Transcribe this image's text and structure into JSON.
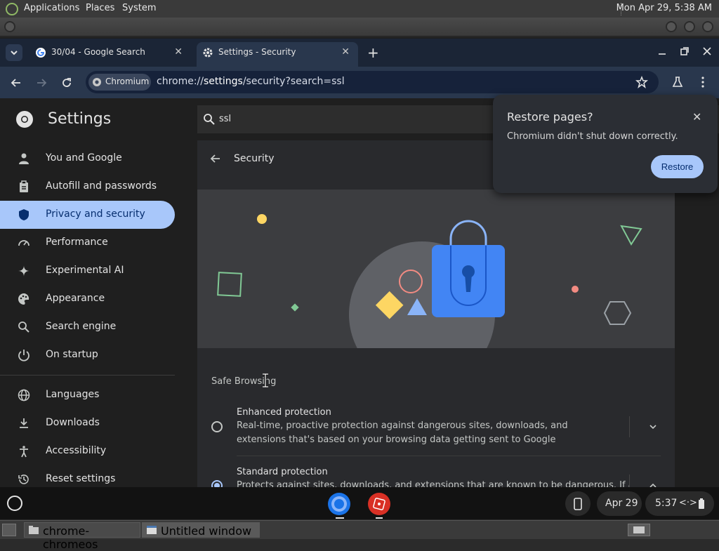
{
  "gnome_panel": {
    "menus": [
      "Applications",
      "Places",
      "System"
    ],
    "clock": "Mon Apr 29, 5:38 AM"
  },
  "tabs": [
    {
      "title": "30/04 - Google Search",
      "icon": "google-icon"
    },
    {
      "title": "Settings - Security",
      "icon": "gear-icon",
      "active": true
    }
  ],
  "toolbar": {
    "chip_label": "Chromium",
    "url_prefix": "chrome://",
    "url_host": "settings",
    "url_path": "/security?search=ssl"
  },
  "settings": {
    "title": "Settings",
    "search_value": "ssl",
    "nav": [
      {
        "label": "You and Google",
        "icon": "person-icon"
      },
      {
        "label": "Autofill and passwords",
        "icon": "clipboard-icon"
      },
      {
        "label": "Privacy and security",
        "icon": "shield-icon",
        "active": true
      },
      {
        "label": "Performance",
        "icon": "speedometer-icon"
      },
      {
        "label": "Experimental AI",
        "icon": "sparkle-icon"
      },
      {
        "label": "Appearance",
        "icon": "palette-icon"
      },
      {
        "label": "Search engine",
        "icon": "search-icon"
      },
      {
        "label": "On startup",
        "icon": "power-icon"
      },
      {
        "label": "Languages",
        "icon": "globe-icon"
      },
      {
        "label": "Downloads",
        "icon": "download-icon"
      },
      {
        "label": "Accessibility",
        "icon": "accessibility-icon"
      },
      {
        "label": "Reset settings",
        "icon": "history-icon"
      }
    ],
    "section_title": "Security",
    "safe_browsing_label": "Safe Browsing",
    "options": [
      {
        "title": "Enhanced protection",
        "desc": "Real-time, proactive protection against dangerous sites, downloads, and extensions that's based on your browsing data getting sent to Google",
        "selected": false
      },
      {
        "title": "Standard protection",
        "desc": "Protects against sites, downloads, and extensions that are known to be dangerous. If a page",
        "selected": true
      }
    ]
  },
  "popup": {
    "title": "Restore pages?",
    "message": "Chromium didn't shut down correctly.",
    "button": "Restore"
  },
  "shelf": {
    "date": "Apr 29",
    "time": "5:37"
  },
  "bottom_panel": {
    "tasks": [
      "chrome-chromeos",
      "Untitled window"
    ]
  },
  "colors": {
    "accent": "#a8c7fa",
    "tab_strip": "#1b2536",
    "toolbar": "#29374d"
  }
}
